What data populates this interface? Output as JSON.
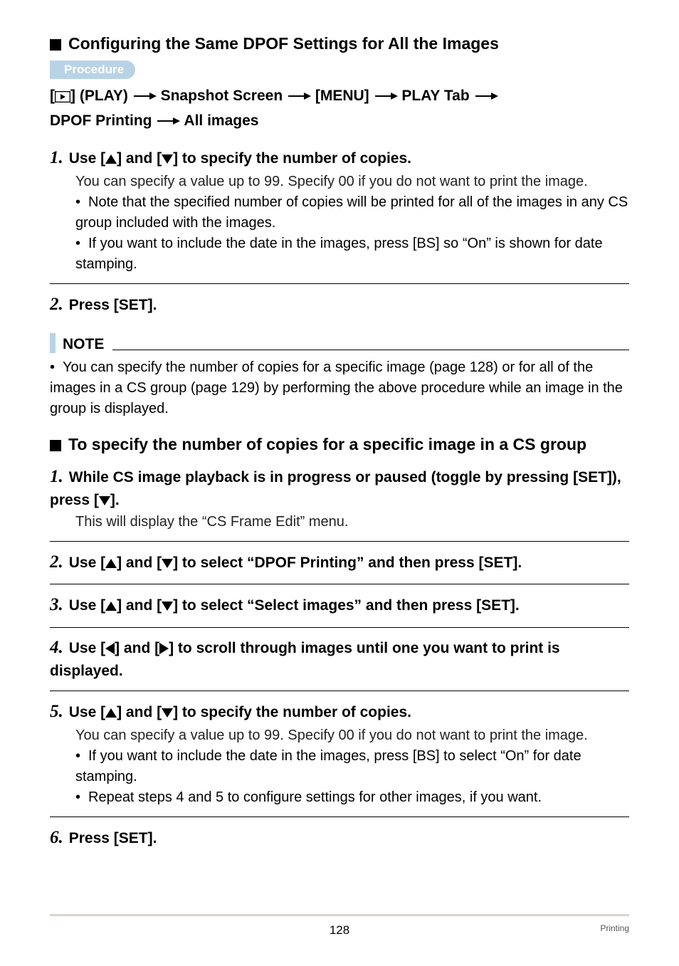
{
  "section1": {
    "title": "Configuring the Same DPOF Settings for All the Images",
    "procedure_label": "Procedure",
    "breadcrumb": {
      "p1_a": "[",
      "p1_b": "] (PLAY)",
      "p2": "Snapshot Screen",
      "p3": "[MENU]",
      "p4": "PLAY Tab",
      "p5": "DPOF Printing",
      "p6": "All images"
    },
    "step1": {
      "num": "1.",
      "pre": "Use [",
      "mid": "] and [",
      "post": "] to specify the number of copies.",
      "body": "You can specify a value up to 99. Specify 00 if you do not want to print the image.",
      "b1": "Note that the specified number of copies will be printed for all of the images in any CS group included with the images.",
      "b2": "If you want to include the date in the images, press [BS] so “On” is shown for date stamping."
    },
    "step2": {
      "num": "2.",
      "text": "Press [SET]."
    }
  },
  "note": {
    "label": "NOTE",
    "text": "You can specify the number of copies for a specific image (page 128) or for all of the images in a CS group (page 129) by performing the above procedure while an image in the group is displayed."
  },
  "section2": {
    "title": "To specify the number of copies for a specific image in a CS group",
    "step1": {
      "num": "1.",
      "line_a": "While CS image playback is in progress or paused (toggle by pressing [SET]), press [",
      "line_b": "].",
      "body": "This will display the “CS Frame Edit” menu."
    },
    "step2": {
      "num": "2.",
      "pre": "Use [",
      "mid": "] and [",
      "post": "] to select “DPOF Printing” and then press [SET]."
    },
    "step3": {
      "num": "3.",
      "pre": "Use [",
      "mid": "] and [",
      "post": "] to select “Select images” and then press [SET]."
    },
    "step4": {
      "num": "4.",
      "pre": "Use [",
      "mid": "] and [",
      "post": "] to scroll through images until one you want to print is displayed."
    },
    "step5": {
      "num": "5.",
      "pre": "Use [",
      "mid": "] and [",
      "post": "] to specify the number of copies.",
      "body": "You can specify a value up to 99. Specify 00 if you do not want to print the image.",
      "b1": "If you want to include the date in the images, press [BS] to select “On” for date stamping.",
      "b2": "Repeat steps 4 and 5 to configure settings for other images, if you want."
    },
    "step6": {
      "num": "6.",
      "text": "Press [SET]."
    }
  },
  "footer": {
    "page": "128",
    "section": "Printing"
  }
}
